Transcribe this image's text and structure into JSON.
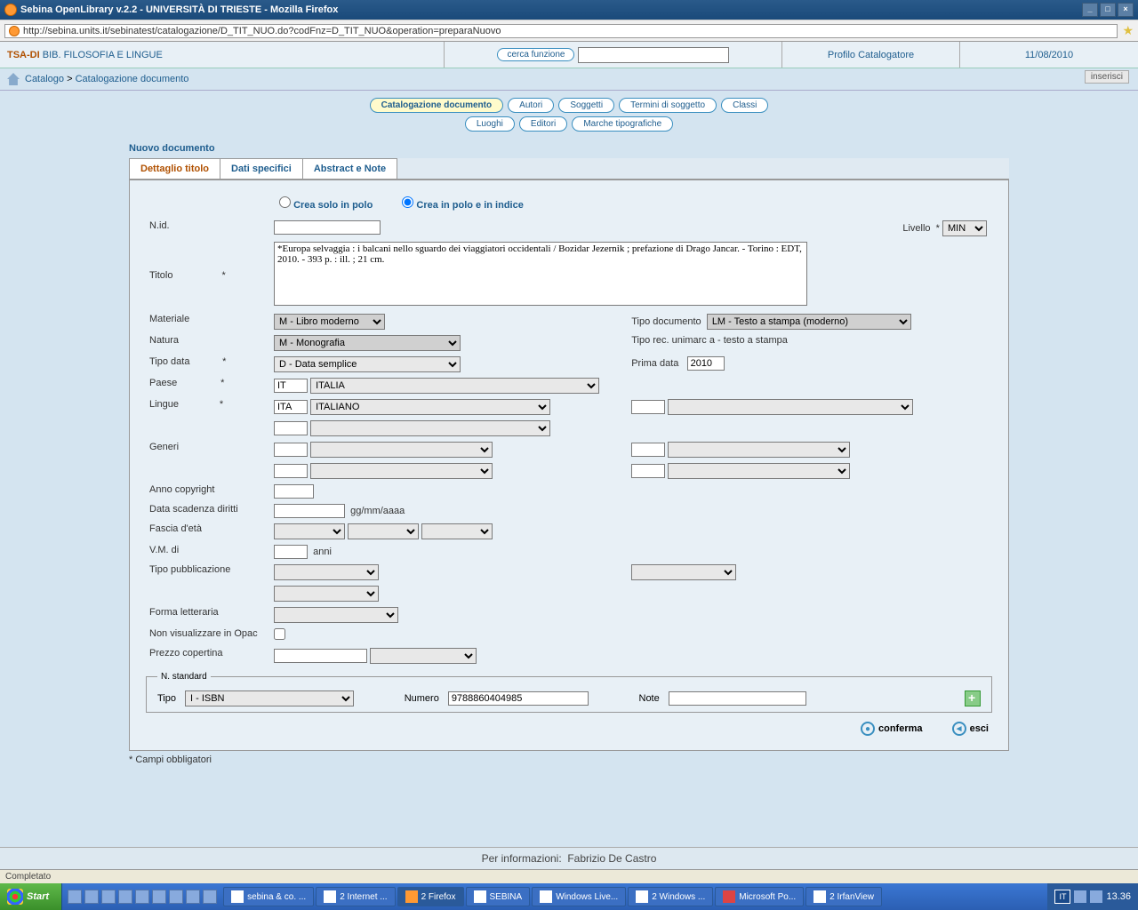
{
  "window": {
    "title": "Sebina OpenLibrary v.2.2 - UNIVERSITÀ DI TRIESTE - Mozilla Firefox",
    "url": "http://sebina.units.it/sebinatest/catalogazione/D_TIT_NUO.do?codFnz=D_TIT_NUO&operation=preparaNuovo"
  },
  "header": {
    "lib_code": "TSA-DI",
    "lib_name": "BIB. FILOSOFIA E LINGUE",
    "search_btn": "cerca funzione",
    "profile": "Profilo Catalogatore",
    "date": "11/08/2010"
  },
  "breadcrumb": {
    "item1": "Catalogo",
    "item2": "Catalogazione documento",
    "mode": "inserisci"
  },
  "pills": {
    "p1": "Catalogazione documento",
    "p2": "Autori",
    "p3": "Soggetti",
    "p4": "Termini di soggetto",
    "p5": "Classi",
    "p6": "Luoghi",
    "p7": "Editori",
    "p8": "Marche tipografiche"
  },
  "section_title": "Nuovo documento",
  "tabs": {
    "t1": "Dettaglio titolo",
    "t2": "Dati specifici",
    "t3": "Abstract e Note"
  },
  "radios": {
    "r1": "Crea solo in polo",
    "r2": "Crea in polo e in indice"
  },
  "labels": {
    "nid": "N.id.",
    "livello": "Livello",
    "titolo": "Titolo",
    "materiale": "Materiale",
    "tipo_doc": "Tipo documento",
    "natura": "Natura",
    "tipo_rec": "Tipo rec. unimarc a - testo a stampa",
    "tipo_data": "Tipo data",
    "prima_data": "Prima data",
    "paese": "Paese",
    "lingue": "Lingue",
    "generi": "Generi",
    "anno_copyright": "Anno copyright",
    "data_scadenza": "Data scadenza diritti",
    "data_hint": "gg/mm/aaaa",
    "fascia_eta": "Fascia d'età",
    "vm_di": "V.M. di",
    "anni": "anni",
    "tipo_pubblicazione": "Tipo pubblicazione",
    "forma_letteraria": "Forma letteraria",
    "non_visualizzare": "Non visualizzare in Opac",
    "prezzo": "Prezzo copertina",
    "nstandard": "N. standard",
    "tipo": "Tipo",
    "numero": "Numero",
    "note": "Note"
  },
  "values": {
    "livello": "MIN",
    "titolo": "*Europa selvaggia : i balcani nello sguardo dei viaggiatori occidentali / Bozidar Jezernik ; prefazione di Drago Jancar. - Torino : EDT, 2010. - 393 p. : ill. ; 21 cm.",
    "materiale": "M - Libro moderno",
    "tipo_doc": "LM - Testo a stampa (moderno)",
    "natura": "M - Monografia",
    "tipo_data": "D - Data semplice",
    "prima_data": "2010",
    "paese_code": "IT",
    "paese_name": "ITALIA",
    "lingue_code": "ITA",
    "lingue_name": "ITALIANO",
    "std_tipo": "I - ISBN",
    "std_numero": "9788860404985"
  },
  "actions": {
    "conferma": "conferma",
    "esci": "esci"
  },
  "mandatory": "* Campi obbligatori",
  "footer": {
    "info_label": "Per informazioni:",
    "info_name": "Fabrizio De Castro"
  },
  "statusbar": "Completato",
  "taskbar": {
    "start": "Start",
    "items": [
      "sebina & co. ...",
      "2 Internet ...",
      "2 Firefox",
      "SEBINA",
      "Windows Live...",
      "2 Windows ...",
      "Microsoft Po...",
      "2 IrfanView"
    ],
    "lang": "IT",
    "clock": "13.36"
  }
}
